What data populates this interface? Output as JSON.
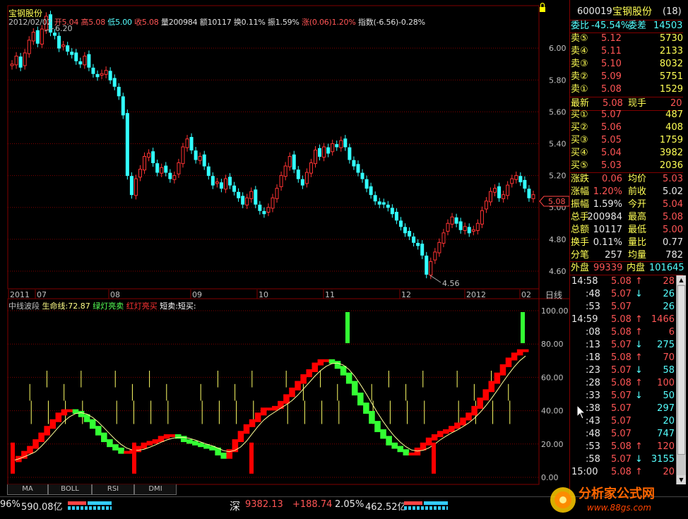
{
  "main_chart": {
    "stock_name": "宝钢股份",
    "info_date": "2012/02/02",
    "info_open": "开5.04",
    "info_high": "高5.08",
    "info_low": "低5.00",
    "info_close": "收5.08",
    "info_volume": "量200984",
    "info_amount": "额10117",
    "info_turnover": "换0.11%",
    "info_amplitude": "振1.59%",
    "info_change": "涨(0.06)1.20%",
    "info_index": "指数(-6.56)-0.28%",
    "high_marker": "6.20",
    "low_marker": "4.56",
    "current_price_tag": "5.08",
    "y_axis_labels": [
      "6.00",
      "5.80",
      "5.60",
      "5.40",
      "5.20",
      "5.00",
      "4.80",
      "4.60"
    ],
    "x_axis_labels": [
      "2011",
      "07",
      "08",
      "09",
      "10",
      "11",
      "12",
      "2012",
      "02"
    ],
    "period_label": "日线",
    "lock_icon": "lock-icon"
  },
  "indicator": {
    "name": "中线波段",
    "lifeline_label": "生命线:72.87",
    "green_signal": "绿灯亮卖",
    "red_signal": "红灯亮买",
    "short_label": "短卖:短买:",
    "y_axis_labels": [
      "100.00",
      "80.00",
      "60.00",
      "40.00",
      "20.00",
      "0.00"
    ],
    "colors": {
      "rise": "#ff0000",
      "fall": "#33ff33",
      "line": "#ffff88",
      "tick": "#ffff66"
    }
  },
  "chart_data": [
    {
      "type": "candlestick",
      "title": "宝钢股份",
      "ylim": [
        4.52,
        6.24
      ],
      "y_ticks": [
        6.0,
        5.8,
        5.6,
        5.4,
        5.2,
        5.0,
        4.8,
        4.6
      ],
      "x_labels": [
        "2011",
        "07",
        "08",
        "09",
        "10",
        "11",
        "12",
        "2012",
        "02"
      ],
      "closes": [
        5.9,
        5.95,
        5.88,
        5.97,
        6.05,
        6.1,
        6.03,
        6.12,
        6.2,
        6.1,
        6.08,
        6.0,
        6.02,
        5.98,
        5.96,
        5.92,
        5.9,
        5.95,
        5.88,
        5.84,
        5.82,
        5.84,
        5.86,
        5.8,
        5.76,
        5.7,
        5.58,
        5.2,
        5.08,
        5.18,
        5.24,
        5.32,
        5.34,
        5.28,
        5.22,
        5.25,
        5.22,
        5.18,
        5.2,
        5.28,
        5.38,
        5.43,
        5.36,
        5.3,
        5.32,
        5.26,
        5.2,
        5.14,
        5.16,
        5.12,
        5.18,
        5.14,
        5.1,
        5.06,
        5.02,
        5.06,
        5.1,
        5.02,
        4.98,
        4.96,
        5.0,
        5.06,
        5.12,
        5.2,
        5.26,
        5.32,
        5.24,
        5.18,
        5.14,
        5.22,
        5.28,
        5.36,
        5.32,
        5.38,
        5.34,
        5.4,
        5.38,
        5.42,
        5.38,
        5.3,
        5.26,
        5.22,
        5.18,
        5.12,
        5.08,
        5.04,
        5.02,
        5.02,
        5.0,
        4.96,
        4.92,
        4.88,
        4.84,
        4.82,
        4.78,
        4.76,
        4.7,
        4.58,
        4.66,
        4.72,
        4.78,
        4.84,
        4.9,
        4.94,
        4.9,
        4.86,
        4.88,
        4.84,
        4.86,
        4.9,
        4.98,
        5.04,
        5.1,
        5.12,
        5.06,
        5.08,
        5.14,
        5.18,
        5.2,
        5.16,
        5.12,
        5.06,
        5.08
      ],
      "high": 6.2,
      "low": 4.56,
      "last": 5.08
    },
    {
      "type": "bar",
      "title": "中线波段",
      "ylim": [
        0,
        100
      ],
      "y_ticks": [
        100,
        80,
        60,
        40,
        20,
        0
      ],
      "lifeline": 72.87,
      "values": [
        10,
        12,
        15,
        18,
        22,
        26,
        30,
        34,
        38,
        40,
        40,
        39,
        37,
        34,
        30,
        26,
        22,
        19,
        17,
        15,
        15,
        16,
        18,
        20,
        21,
        22,
        24,
        25,
        25,
        24,
        22,
        21,
        20,
        19,
        18,
        17,
        14,
        12,
        16,
        22,
        27,
        31,
        34,
        38,
        41,
        41,
        42,
        45,
        49,
        53,
        57,
        61,
        64,
        68,
        70,
        70,
        69,
        66,
        62,
        57,
        50,
        44,
        39,
        33,
        28,
        24,
        20,
        18,
        16,
        14,
        14,
        17,
        20,
        23,
        25,
        27,
        28,
        30,
        32,
        35,
        38,
        42,
        47,
        52,
        57,
        62,
        67,
        71,
        74,
        76,
        76
      ],
      "sell_signals": [
        78
      ],
      "buy_signals": [
        126
      ]
    }
  ],
  "right_panel": {
    "code": "600019",
    "name": "宝钢股份",
    "badge": "(18)",
    "weibi_label": "委比",
    "weibi_value": "-45.54%",
    "weicha_label": "委差",
    "weicha_value": "14503",
    "asks": [
      {
        "label": "卖⑤",
        "price": "5.12",
        "vol": "5730"
      },
      {
        "label": "卖④",
        "price": "5.11",
        "vol": "2133"
      },
      {
        "label": "卖③",
        "price": "5.10",
        "vol": "8032"
      },
      {
        "label": "卖②",
        "price": "5.09",
        "vol": "5751"
      },
      {
        "label": "卖①",
        "price": "5.08",
        "vol": "1529"
      }
    ],
    "latest_label": "最新",
    "latest_value": "5.08",
    "xianshou_label": "现手",
    "xianshou_value": "20",
    "bids": [
      {
        "label": "买①",
        "price": "5.07",
        "vol": "487"
      },
      {
        "label": "买②",
        "price": "5.06",
        "vol": "408"
      },
      {
        "label": "买③",
        "price": "5.05",
        "vol": "1759"
      },
      {
        "label": "买④",
        "price": "5.04",
        "vol": "3982"
      },
      {
        "label": "买⑤",
        "price": "5.03",
        "vol": "2036"
      }
    ],
    "stats": [
      {
        "l1": "涨跌",
        "v1": "0.06",
        "c1": "red",
        "l2": "均价",
        "v2": "5.03",
        "c2": "red"
      },
      {
        "l1": "涨幅",
        "v1": "1.20%",
        "c1": "red",
        "l2": "前收",
        "v2": "5.02",
        "c2": "white"
      },
      {
        "l1": "振幅",
        "v1": "1.59%",
        "c1": "white",
        "l2": "今开",
        "v2": "5.04",
        "c2": "red"
      },
      {
        "l1": "总手",
        "v1": "200984",
        "c1": "white",
        "l2": "最高",
        "v2": "5.08",
        "c2": "red"
      },
      {
        "l1": "总额",
        "v1": "10117",
        "c1": "white",
        "l2": "最低",
        "v2": "5.00",
        "c2": "red"
      },
      {
        "l1": "换手",
        "v1": "0.11%",
        "c1": "white",
        "l2": "量比",
        "v2": "0.77",
        "c2": "white"
      },
      {
        "l1": "分笔",
        "v1": "257",
        "c1": "white",
        "l2": "均量",
        "v2": "782",
        "c2": "white"
      }
    ],
    "waipan_label": "外盘",
    "waipan_value": "99339",
    "neipan_label": "内盘",
    "neipan_value": "101645",
    "ticks": [
      {
        "time": "14:58",
        "price": "5.08",
        "dir": "up",
        "vol": "28",
        "bold": true
      },
      {
        "time": ":48",
        "price": "5.07",
        "dir": "down",
        "vol": "26",
        "bold": false
      },
      {
        "time": ":53",
        "price": "5.07",
        "dir": "",
        "vol": "26",
        "bold": false
      },
      {
        "time": "14:59",
        "price": "5.08",
        "dir": "up",
        "vol": "1466",
        "bold": true
      },
      {
        "time": ":08",
        "price": "5.08",
        "dir": "up",
        "vol": "6",
        "bold": false
      },
      {
        "time": ":13",
        "price": "5.07",
        "dir": "down",
        "vol": "275",
        "bold": false
      },
      {
        "time": ":18",
        "price": "5.08",
        "dir": "up",
        "vol": "70",
        "bold": false
      },
      {
        "time": ":23",
        "price": "5.07",
        "dir": "down",
        "vol": "58",
        "bold": false
      },
      {
        "time": ":28",
        "price": "5.08",
        "dir": "up",
        "vol": "100",
        "bold": false
      },
      {
        "time": ":33",
        "price": "5.07",
        "dir": "down",
        "vol": "50",
        "bold": false
      },
      {
        "time": ":38",
        "price": "5.07",
        "dir": "",
        "vol": "297",
        "bold": false
      },
      {
        "time": ":43",
        "price": "5.07",
        "dir": "",
        "vol": "20",
        "bold": false
      },
      {
        "time": ":48",
        "price": "5.07",
        "dir": "",
        "vol": "747",
        "bold": false
      },
      {
        "time": ":53",
        "price": "5.08",
        "dir": "up",
        "vol": "120",
        "bold": false
      },
      {
        "time": ":58",
        "price": "5.07",
        "dir": "down",
        "vol": "3155",
        "bold": false
      },
      {
        "time": "15:00",
        "price": "5.08",
        "dir": "up",
        "vol": "20",
        "bold": true
      }
    ]
  },
  "tabs": [
    "MA",
    "BOLL",
    "RSI",
    "DMI"
  ],
  "status_bar": {
    "left_pct": "96%",
    "left_amount": "590.08亿",
    "sz_label": "深",
    "sz_index": "9382.13",
    "sz_change": "+188.74",
    "sz_pct": "2.05%",
    "sz_amount": "462.52亿"
  },
  "watermark": {
    "title": "分析家公式网",
    "url": "www.88gs.com"
  }
}
